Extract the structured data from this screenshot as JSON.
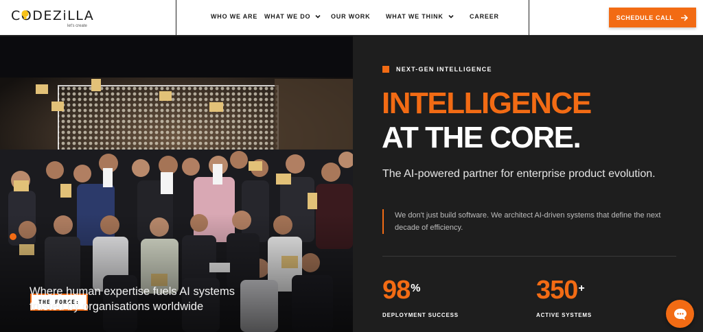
{
  "brand": {
    "name": "CODEZiLLA",
    "tagline": "let's create",
    "accent": "#f26b14"
  },
  "nav": {
    "items": [
      {
        "label": "WHO WE ARE",
        "dropdown": false
      },
      {
        "label": "WHAT WE DO",
        "dropdown": true
      },
      {
        "label": "OUR WORK",
        "dropdown": false
      },
      {
        "label": "WHAT WE THINK",
        "dropdown": true
      },
      {
        "label": "CAREER",
        "dropdown": false
      }
    ],
    "cta_label": "SCHEDULE CALL",
    "cta_icon": "arrow-right-icon"
  },
  "hero_photo": {
    "tag": "THE FORCE:",
    "caption": "Where human expertise fuels AI systems trusted by organisations worldwide"
  },
  "hero": {
    "eyebrow": "NEXT-GEN INTELLIGENCE",
    "title_line1": "INTELLIGENCE",
    "title_line2": "AT THE CORE.",
    "lede": "The AI-powered partner for enterprise product evolution.",
    "quote": "We don't just build software. We architect AI-driven systems that define the next decade of efficiency."
  },
  "stats": [
    {
      "value": "98",
      "suffix": "%",
      "label": "DEPLOYMENT SUCCESS"
    },
    {
      "value": "350",
      "suffix": "+",
      "label": "ACTIVE SYSTEMS"
    }
  ],
  "chat": {
    "icon": "chat-bubble-icon"
  }
}
